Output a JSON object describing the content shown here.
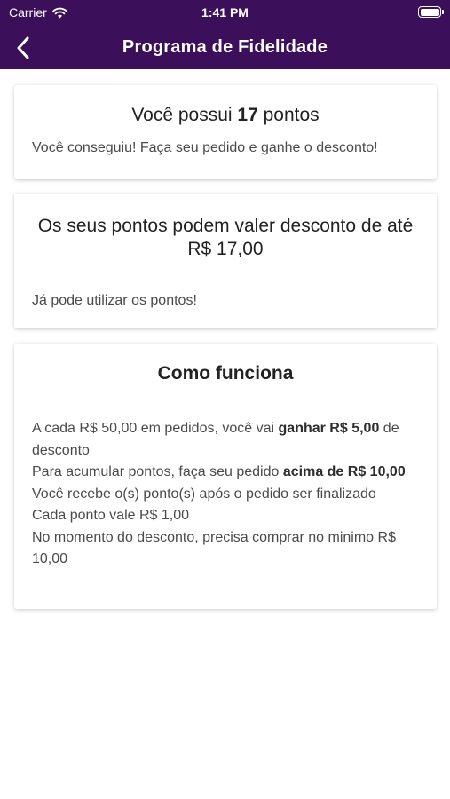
{
  "status_bar": {
    "carrier": "Carrier",
    "time": "1:41 PM",
    "battery_level": 1.0
  },
  "nav": {
    "title": "Programa de Fidelidade",
    "back_icon": "chevron-left-icon",
    "background": "#3c0f5a"
  },
  "points_card": {
    "prefix": "Você possui ",
    "points": "17",
    "suffix": " pontos",
    "message": "Você conseguiu! Faça seu pedido e ganhe o desconto!"
  },
  "discount_card": {
    "heading": "Os seus pontos podem valer desconto de até R$ 17,00",
    "message": "Já pode utilizar os pontos!"
  },
  "how_it_works": {
    "title": "Como funciona",
    "items": [
      {
        "pre": "A cada R$ 50,00 em pedidos, você vai ",
        "bold": "ganhar R$ 5,00",
        "post": " de desconto"
      },
      {
        "pre": "Para acumular pontos, faça seu pedido ",
        "bold": "acima de R$ 10,00",
        "post": ""
      },
      {
        "pre": "Você recebe o(s) ponto(s) após o pedido ser finalizado",
        "bold": "",
        "post": ""
      },
      {
        "pre": "Cada ponto vale R$ 1,00",
        "bold": "",
        "post": ""
      },
      {
        "pre": "No momento do desconto, precisa comprar no minimo R$ 10,00",
        "bold": "",
        "post": ""
      }
    ]
  }
}
